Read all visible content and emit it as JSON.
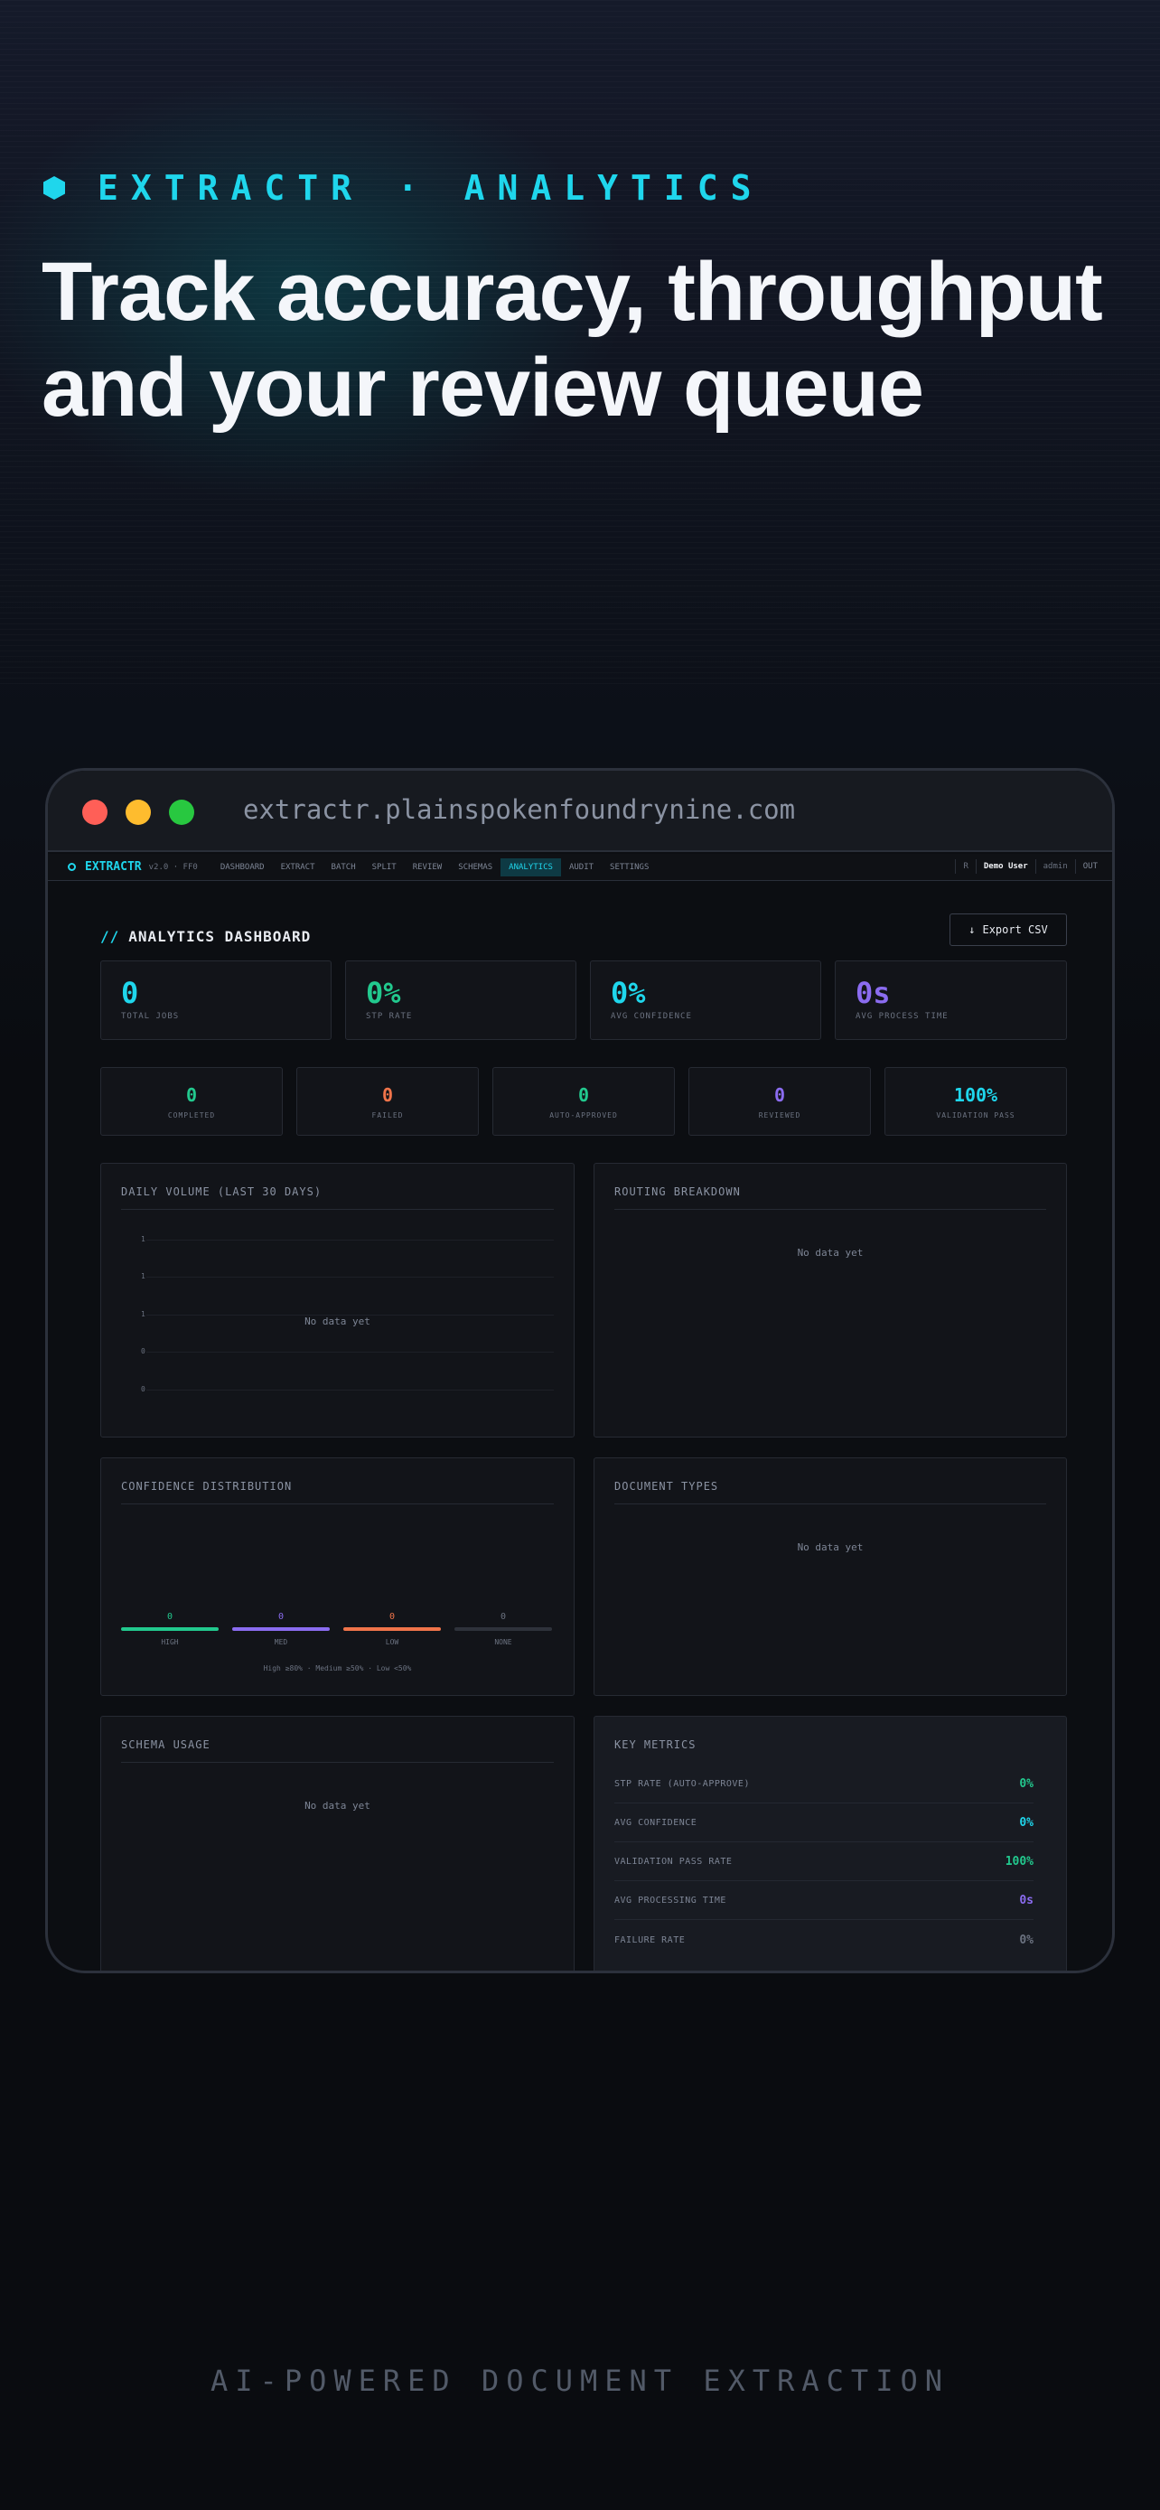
{
  "hero": {
    "eyebrow": "EXTRACTR · ANALYTICS",
    "headline_line1": "Track accuracy, throughput",
    "headline_line2": "and your review queue",
    "footer_tagline": "AI-POWERED DOCUMENT EXTRACTION"
  },
  "browser": {
    "url": "extractr.plainspokenfoundrynine.com"
  },
  "app_nav": {
    "brand": "EXTRACTR",
    "version": "v2.0 · FF0",
    "links": [
      "DASHBOARD",
      "EXTRACT",
      "BATCH",
      "SPLIT",
      "REVIEW",
      "SCHEMAS",
      "ANALYTICS",
      "AUDIT",
      "SETTINGS"
    ],
    "active": "ANALYTICS",
    "user_badge": "R",
    "user": "Demo User",
    "role": "admin",
    "logout": "OUT"
  },
  "page": {
    "title_prefix": "//",
    "title": "ANALYTICS DASHBOARD",
    "export_icon": "↓",
    "export_label": "Export CSV"
  },
  "stats": [
    {
      "value": "0",
      "label": "TOTAL JOBS",
      "color": "#1fd6ec"
    },
    {
      "value": "0%",
      "label": "STP RATE",
      "color": "#22c98e"
    },
    {
      "value": "0%",
      "label": "AVG CONFIDENCE",
      "color": "#1fd6ec"
    },
    {
      "value": "0s",
      "label": "AVG PROCESS TIME",
      "color": "#8b6cf0"
    }
  ],
  "status_counts": [
    {
      "value": "0",
      "label": "COMPLETED",
      "color": "#22c98e"
    },
    {
      "value": "0",
      "label": "FAILED",
      "color": "#f0744a"
    },
    {
      "value": "0",
      "label": "AUTO-APPROVED",
      "color": "#22c98e"
    },
    {
      "value": "0",
      "label": "REVIEWED",
      "color": "#8b6cf0"
    },
    {
      "value": "100%",
      "label": "VALIDATION PASS",
      "color": "#1fd6ec"
    }
  ],
  "daily_volume": {
    "title": "DAILY VOLUME (LAST 30 DAYS)",
    "y_ticks": [
      "1",
      "1",
      "1",
      "0",
      "0"
    ],
    "empty": "No data yet"
  },
  "routing": {
    "title": "ROUTING BREAKDOWN",
    "empty": "No data yet"
  },
  "confidence": {
    "title": "CONFIDENCE DISTRIBUTION",
    "buckets": [
      {
        "label": "HIGH",
        "value": "0",
        "color": "#22c98e"
      },
      {
        "label": "MED",
        "value": "0",
        "color": "#8b6cf0"
      },
      {
        "label": "LOW",
        "value": "0",
        "color": "#f0744a"
      },
      {
        "label": "NONE",
        "value": "0",
        "color": "#3a3f4a"
      }
    ],
    "legend": "High ≥80% · Medium ≥50% · Low <50%"
  },
  "doc_types": {
    "title": "DOCUMENT TYPES",
    "empty": "No data yet"
  },
  "schema_usage": {
    "title": "SCHEMA USAGE",
    "empty": "No data yet"
  },
  "key_metrics": {
    "title": "KEY METRICS",
    "rows": [
      {
        "label": "STP RATE (AUTO-APPROVE)",
        "value": "0%",
        "color": "#22c98e"
      },
      {
        "label": "AVG CONFIDENCE",
        "value": "0%",
        "color": "#1fd6ec"
      },
      {
        "label": "VALIDATION PASS RATE",
        "value": "100%",
        "color": "#22c98e"
      },
      {
        "label": "AVG PROCESSING TIME",
        "value": "0s",
        "color": "#8b6cf0"
      },
      {
        "label": "FAILURE RATE",
        "value": "0%",
        "color": "#6b7280"
      }
    ]
  }
}
